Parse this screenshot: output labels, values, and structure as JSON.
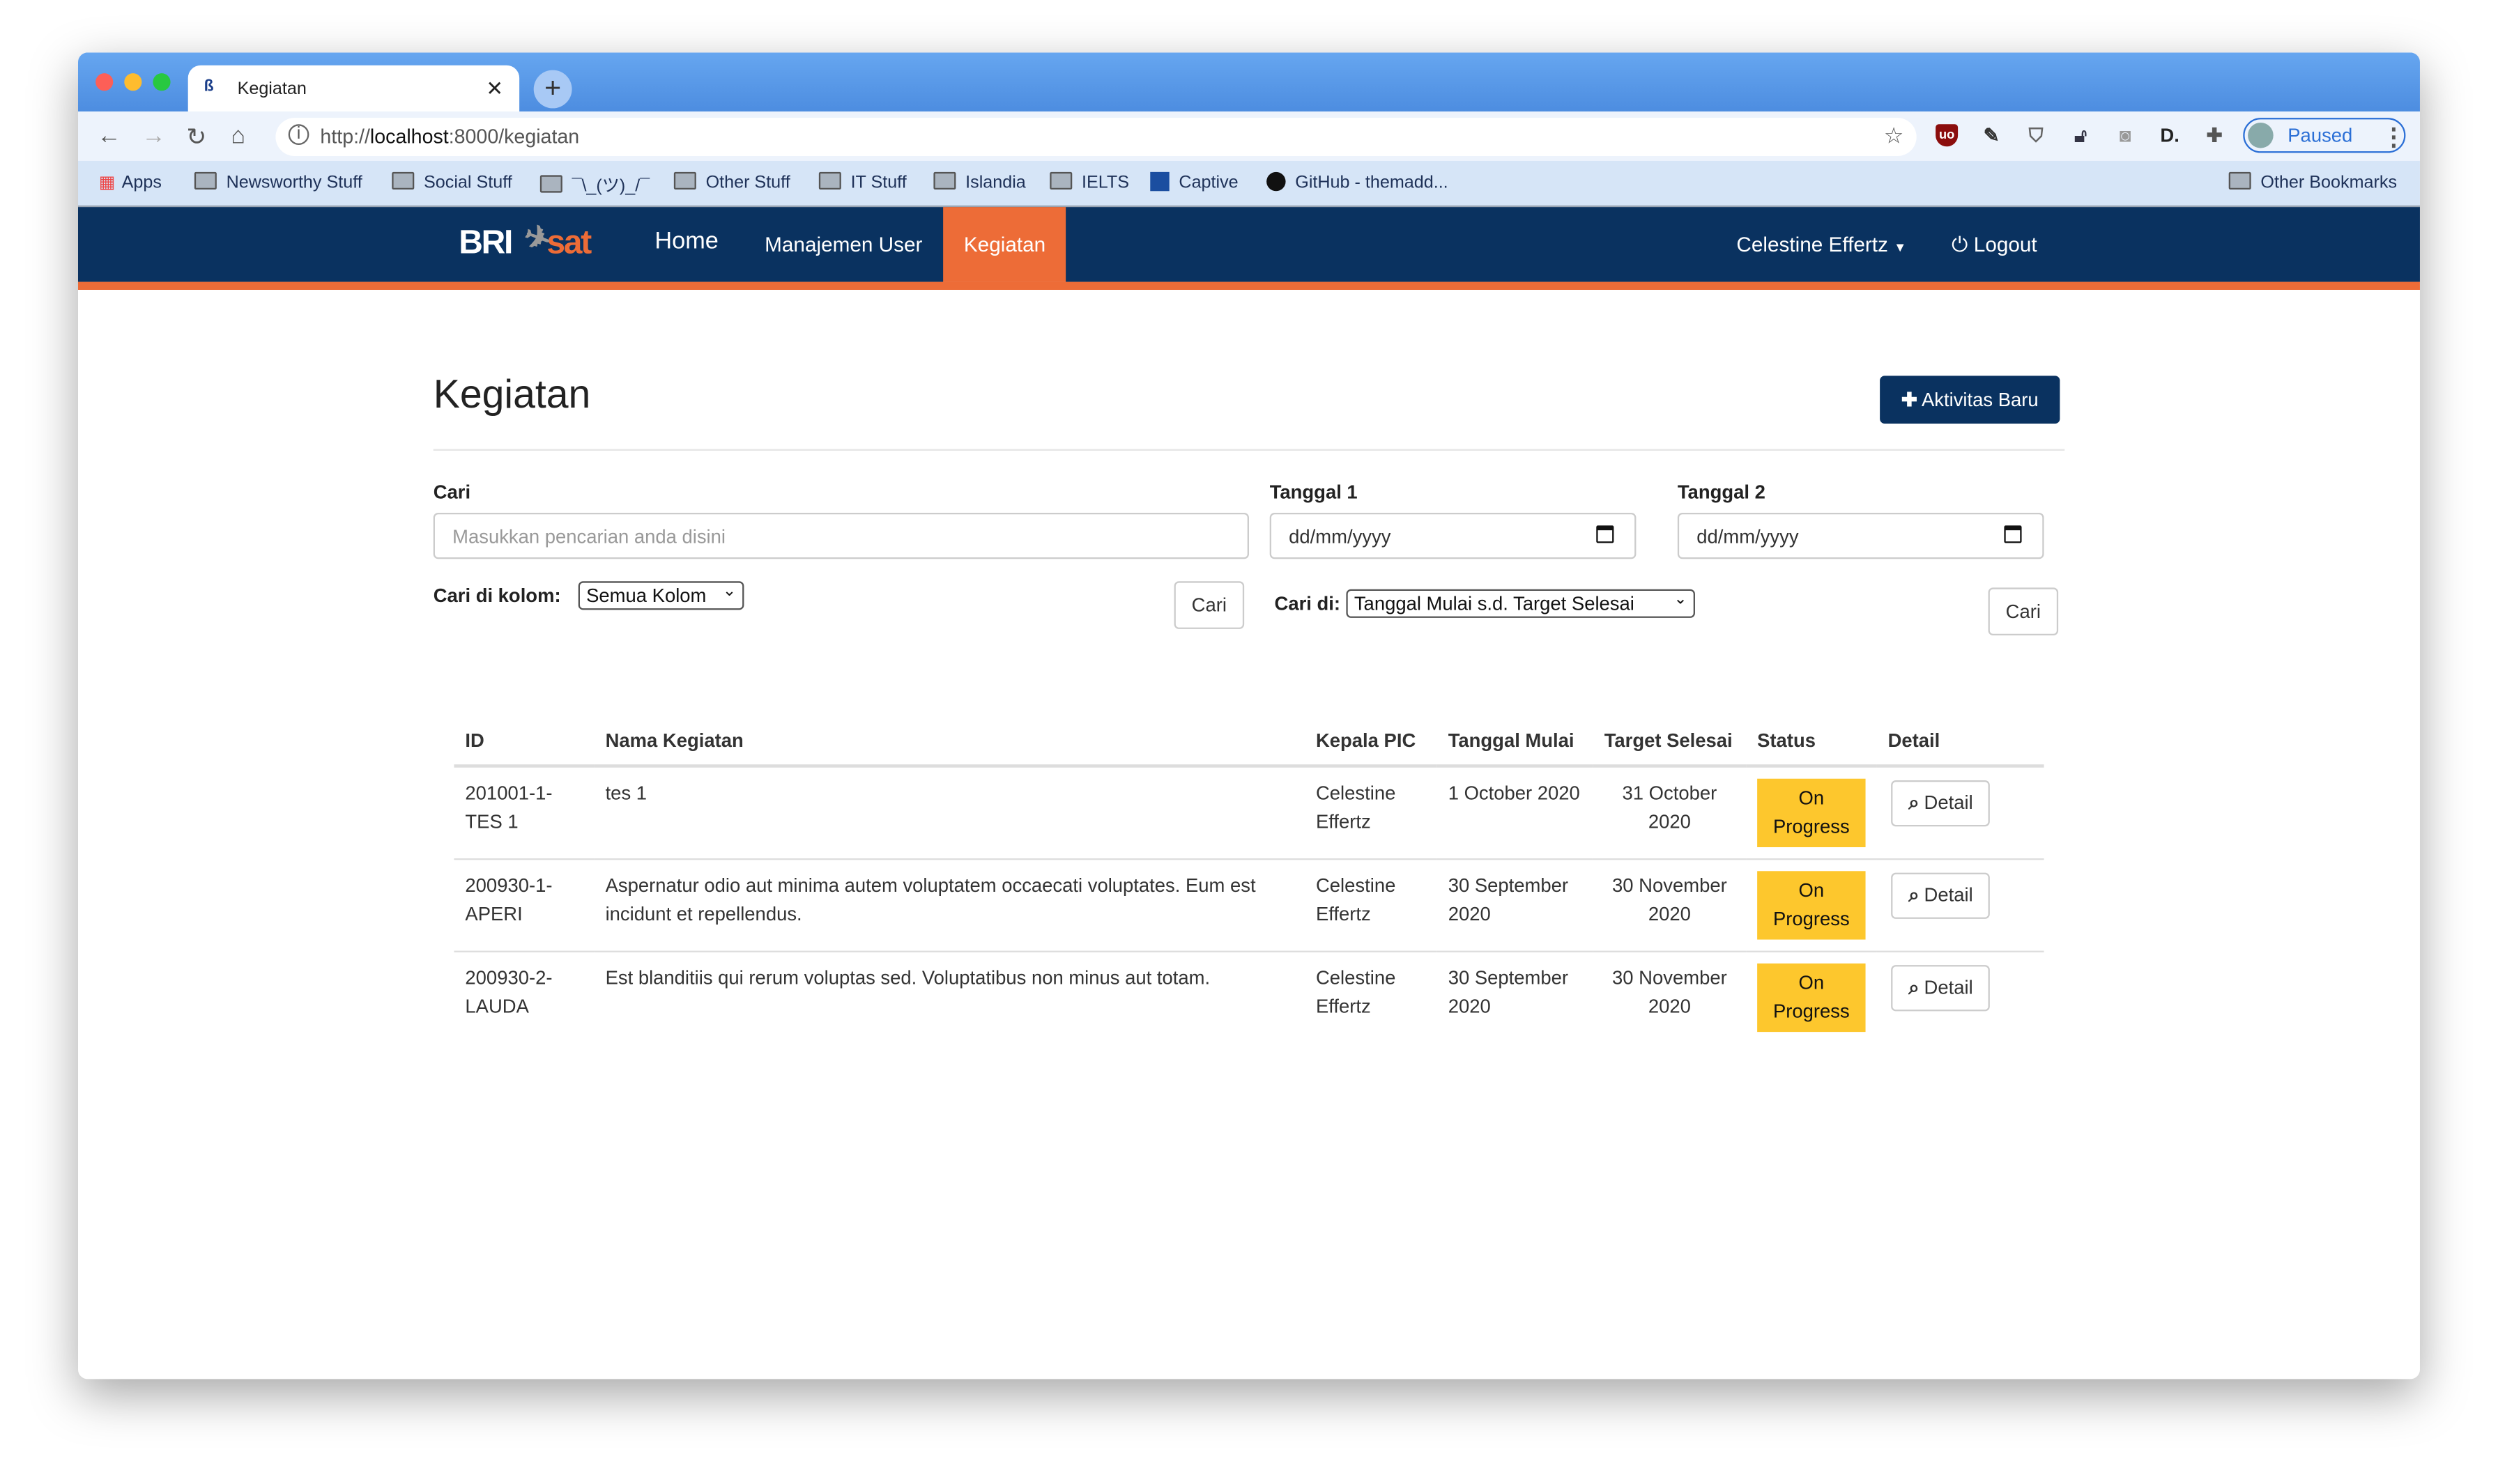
{
  "browser": {
    "tab_title": "Kegiatan",
    "url_prefix": "http://",
    "url_host": "localhost",
    "url_rest": ":8000/kegiatan",
    "profile_label": "Paused",
    "bookmarks": [
      "Apps",
      "Newsworthy Stuff",
      "Social Stuff",
      "¯\\_(ツ)_/¯",
      "Other Stuff",
      "IT Stuff",
      "Islandia",
      "IELTS",
      "Captive",
      "GitHub - themadd..."
    ],
    "other_bookmarks": "Other Bookmarks"
  },
  "navbar": {
    "brand_left": "BRI",
    "brand_right": "sat",
    "items": [
      "Home",
      "Manajemen User",
      "Kegiatan"
    ],
    "active": "Kegiatan",
    "user": "Celestine Effertz",
    "logout": "Logout",
    "colors": {
      "navy": "#0a3260",
      "orange": "#ed6c37"
    }
  },
  "page": {
    "title": "Kegiatan",
    "new_button": "Aktivitas Baru",
    "search": {
      "label": "Cari",
      "placeholder": "Masukkan pencarian anda disini",
      "column_label": "Cari di kolom:",
      "column_value": "Semua Kolom",
      "button": "Cari"
    },
    "date1": {
      "label": "Tanggal 1",
      "placeholder": "dd/mm/yyyy"
    },
    "date2": {
      "label": "Tanggal 2",
      "placeholder": "dd/mm/yyyy"
    },
    "date_search": {
      "label": "Cari di:",
      "value": "Tanggal Mulai s.d. Target Selesai",
      "button": "Cari"
    }
  },
  "table": {
    "headers": [
      "ID",
      "Nama Kegiatan",
      "Kepala PIC",
      "Tanggal Mulai",
      "Target Selesai",
      "Status",
      "Detail"
    ],
    "rows": [
      {
        "id": "201001-1-TES 1",
        "nama": "tes 1",
        "pic": "Celestine Effertz",
        "mulai": "1 October 2020",
        "selesai": "31 October 2020",
        "status": "On Progress",
        "detail": "Detail"
      },
      {
        "id": "200930-1-APERI",
        "nama": "Aspernatur odio aut minima autem voluptatem occaecati voluptates. Eum est incidunt et repellendus.",
        "pic": "Celestine Effertz",
        "mulai": "30 September 2020",
        "selesai": "30 November 2020",
        "status": "On Progress",
        "detail": "Detail"
      },
      {
        "id": "200930-2-LAUDA",
        "nama": "Est blanditiis qui rerum voluptas sed. Voluptatibus non minus aut totam.",
        "pic": "Celestine Effertz",
        "mulai": "30 September 2020",
        "selesai": "30 November 2020",
        "status": "On Progress",
        "detail": "Detail"
      }
    ],
    "status_color": "#fdc72d"
  }
}
